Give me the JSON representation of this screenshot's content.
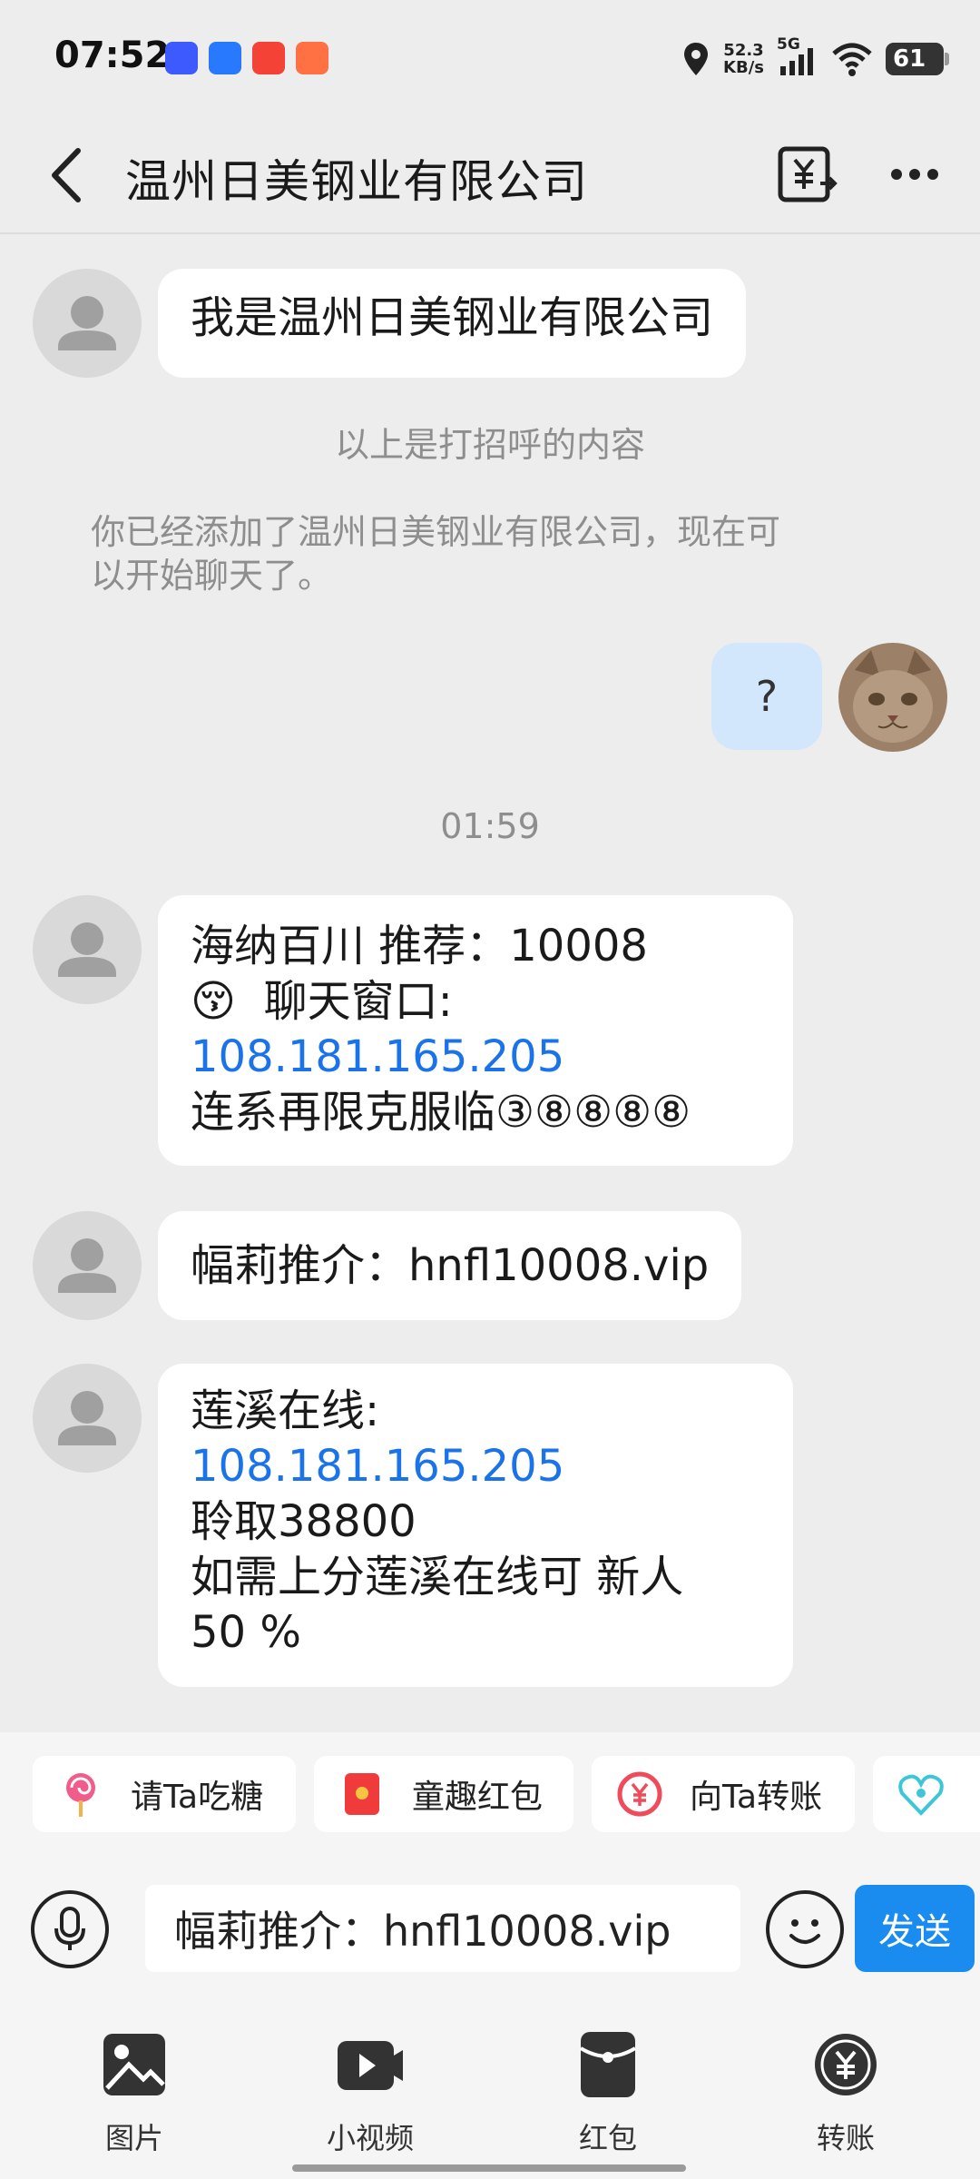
{
  "status_bar": {
    "time": "07:52",
    "net_speed_value": "52.3",
    "net_speed_unit": "KB/s",
    "network": "5G",
    "battery": "61"
  },
  "header": {
    "title": "温州日美钢业有限公司",
    "back_icon": "chevron-left-icon",
    "transfer_icon": "yuan-transfer-icon",
    "more_icon": "more-dots-icon"
  },
  "chat": {
    "greeting": "我是温州日美钢业有限公司",
    "greeting_note": "以上是打招呼的内容",
    "added_notice_line1": "你已经添加了温州日美钢业有限公司，现在可",
    "added_notice_line2": "以开始聊天了。",
    "my_message": "?",
    "timestamp": "01:59",
    "msg1_line1": "海纳百川 推荐：10008",
    "msg1_emoji": "😚",
    "msg1_line2": "聊天窗口:",
    "msg1_link": "108.181.165.205",
    "msg1_line4": "连系再限克服临③⑧⑧⑧⑧",
    "msg2": "幅莉推介：hnfl10008.vip",
    "msg3_line1": "莲溪在线:",
    "msg3_link": "108.181.165.205",
    "msg3_line3": "聆取38800",
    "msg3_line4": "如需上分莲溪在线可 新人",
    "msg3_line5": "50 %"
  },
  "quick_actions": [
    {
      "label": "请Ta吃糖",
      "icon": "lollipop-icon"
    },
    {
      "label": "童趣红包",
      "icon": "red-envelope-icon"
    },
    {
      "label": "向Ta转账",
      "icon": "yuan-transfer-icon"
    }
  ],
  "input": {
    "value": "幅莉推介：hnfl10008.vip",
    "send_label": "发送"
  },
  "toolbar": [
    {
      "label": "图片",
      "icon": "image-icon"
    },
    {
      "label": "小视频",
      "icon": "video-icon"
    },
    {
      "label": "红包",
      "icon": "red-packet-icon"
    },
    {
      "label": "转账",
      "icon": "transfer-icon"
    }
  ],
  "colors": {
    "background": "#ededed",
    "bubble_other": "#ffffff",
    "bubble_me": "#d2e7fb",
    "link": "#1a73e8",
    "send_button": "#1a8cf0",
    "system_text": "#8e8e8e"
  }
}
